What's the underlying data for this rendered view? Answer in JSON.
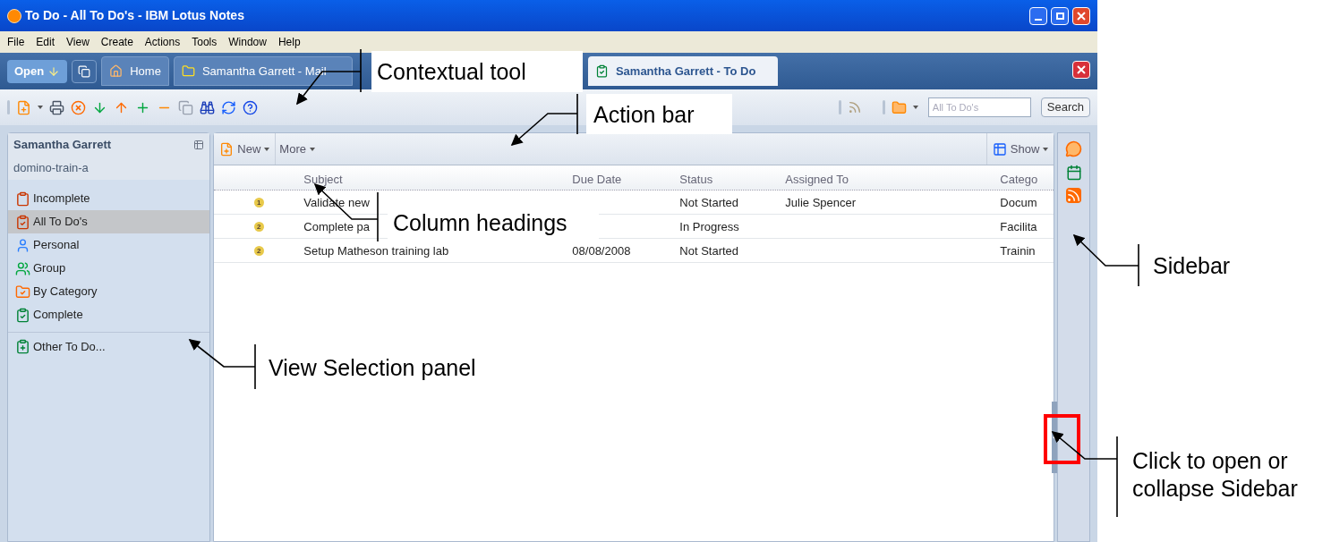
{
  "window": {
    "title": "To Do - All To Do's - IBM Lotus Notes"
  },
  "menu": [
    "File",
    "Edit",
    "View",
    "Create",
    "Actions",
    "Tools",
    "Window",
    "Help"
  ],
  "tabs": [
    {
      "kind": "open",
      "label": "Open",
      "selected": false
    },
    {
      "kind": "windows",
      "selected": false
    },
    {
      "kind": "home",
      "label": "Home",
      "selected": false
    },
    {
      "kind": "mail",
      "label": "Samantha Garrett - Mail",
      "selected": false
    },
    {
      "kind": "todo",
      "label": "Samantha Garrett - To Do",
      "selected": true
    }
  ],
  "search": {
    "placeholder": "All To Do's",
    "button": "Search"
  },
  "nav": {
    "user": "Samantha Garrett",
    "server": "domino-train-a",
    "views": [
      {
        "kind": "incomplete",
        "label": "Incomplete",
        "selected": false
      },
      {
        "kind": "all",
        "label": "All To Do's",
        "selected": true
      },
      {
        "kind": "personal",
        "label": "Personal",
        "selected": false
      },
      {
        "kind": "group",
        "label": "Group",
        "selected": false
      },
      {
        "kind": "category",
        "label": "By Category",
        "selected": false
      },
      {
        "kind": "complete",
        "label": "Complete",
        "selected": false
      }
    ],
    "other": "Other To Do..."
  },
  "action_bar": {
    "new": "New",
    "more": "More",
    "show": "Show"
  },
  "table": {
    "columns": [
      "Subject",
      "Due Date",
      "Status",
      "Assigned To",
      "Catego"
    ],
    "rows": [
      {
        "priority": "1",
        "subject": "Validate new",
        "due_date": "",
        "status": "Not Started",
        "assigned_to": "Julie Spencer",
        "category": "Docum"
      },
      {
        "priority": "2",
        "subject": "Complete pa",
        "due_date": "",
        "status": "In Progress",
        "assigned_to": "",
        "category": "Facilita"
      },
      {
        "priority": "2",
        "subject": "Setup Matheson training lab",
        "due_date": "08/08/2008",
        "status": "Not Started",
        "assigned_to": "",
        "category": "Trainin"
      }
    ]
  },
  "annotations": [
    {
      "kind": "contextual",
      "text": "Contextual tool"
    },
    {
      "kind": "action",
      "text": "Action bar"
    },
    {
      "kind": "columns",
      "text": "Column headings"
    },
    {
      "kind": "sidebar",
      "text": "Sidebar"
    },
    {
      "kind": "views",
      "text": "View Selection panel"
    },
    {
      "kind": "toggle",
      "text": "Click to open or collapse Sidebar"
    }
  ]
}
